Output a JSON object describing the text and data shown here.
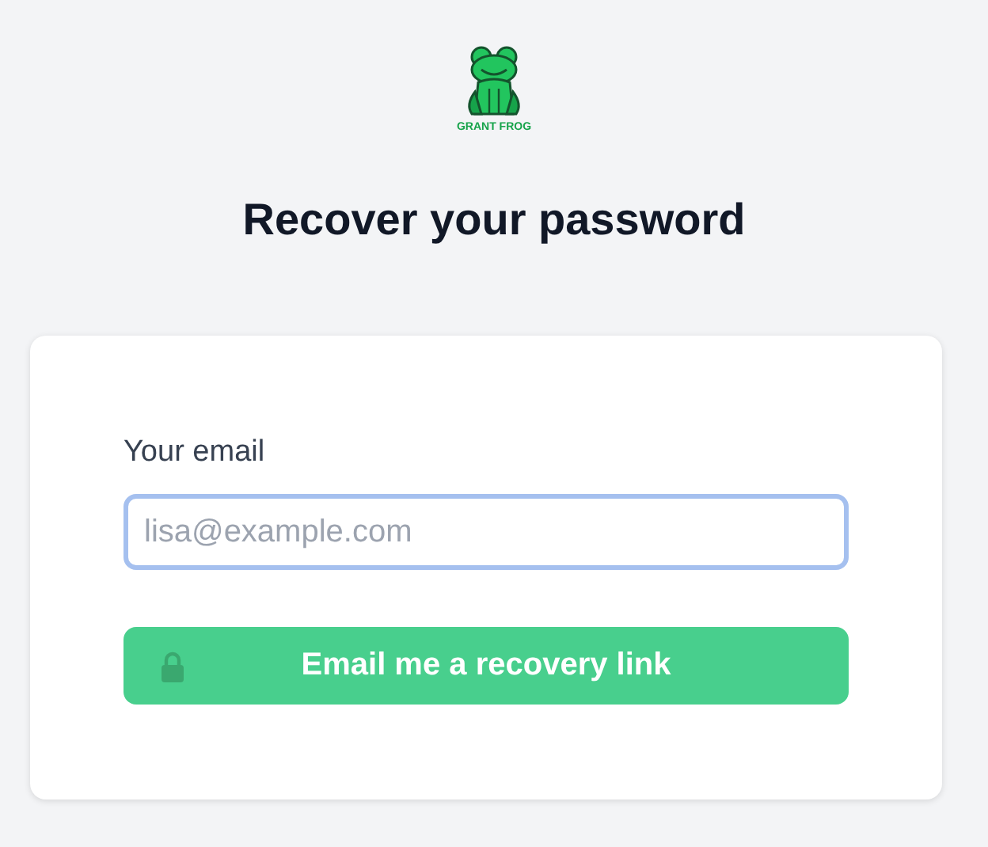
{
  "logo": {
    "text": "GRANT FROG"
  },
  "title": "Recover your password",
  "form": {
    "email_label": "Your email",
    "email_placeholder": "lisa@example.com",
    "email_focused": true,
    "submit": "Email me a recovery link"
  }
}
